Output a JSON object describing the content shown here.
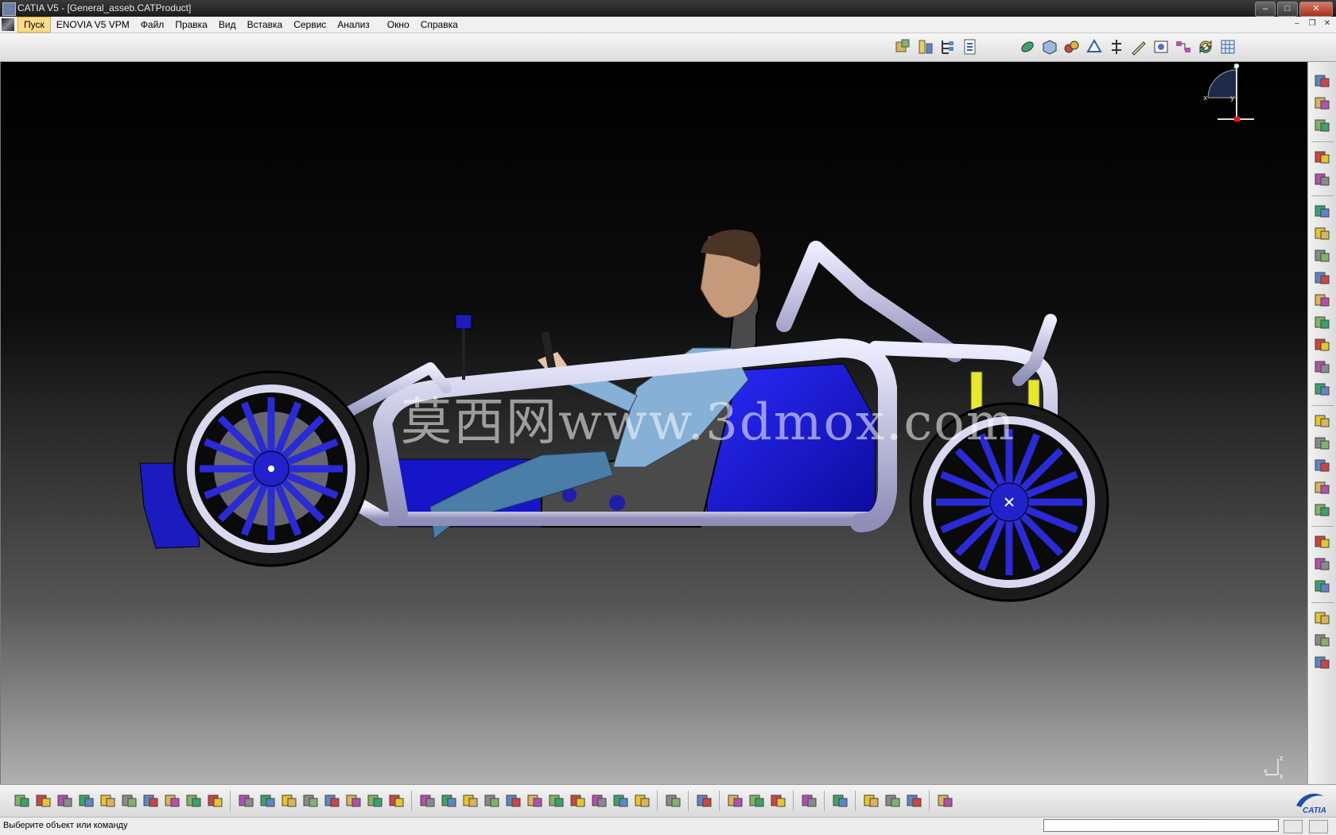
{
  "window": {
    "title": "CATIA V5 - [General_asseb.CATProduct]",
    "controls": {
      "minimize": "–",
      "maximize": "□",
      "close": "✕"
    }
  },
  "menu": {
    "items": [
      "Пуск",
      "ENOVIA V5 VPM",
      "Файл",
      "Правка",
      "Вид",
      "Вставка",
      "Сервис",
      "Анализ",
      "Окно",
      "Справка"
    ],
    "active_index": 0,
    "mdi_controls": {
      "minimize": "–",
      "restore": "❐",
      "close": "✕"
    }
  },
  "top_toolbar": {
    "icons": [
      "assembly-constraints-icon",
      "product-structure-icon",
      "spec-tree-icon",
      "catalog-icon",
      "render-icon",
      "sectioning-icon",
      "clash-icon",
      "measure-icon",
      "distance-icon",
      "sketch-icon",
      "snapshot-icon",
      "connect-icon",
      "update-icon",
      "grid-icon"
    ]
  },
  "viewport": {
    "watermark": "莫西网www.3dmox.com",
    "compass_labels": {
      "x": "x",
      "y": "y",
      "z": "z"
    },
    "colors": {
      "background_top": "#000000",
      "background_bottom": "#b0b0b0",
      "frame_tube": "#c9c9e6",
      "body_panel": "#1414c8",
      "tire": "#1b1b1b",
      "driver_suit": "#4a7ea8",
      "shock_absorber": "#e8e82a"
    }
  },
  "right_toolbar": {
    "icons": [
      "gear-icon",
      "doc-icon",
      "doc-icon",
      "select-arrow-icon",
      "manipulate-icon",
      "component-icon",
      "component-icon",
      "component-icon",
      "insert-icon",
      "replace-icon",
      "move-icon",
      "reorder-icon",
      "table-icon",
      "multi-instantiate-icon",
      "bill-of-material-icon",
      "constraint-icon",
      "constraint-icon",
      "fix-icon",
      "coincidence-icon",
      "contact-icon",
      "offset-icon",
      "angle-icon",
      "update-icon",
      "publish-icon",
      "scene-icon"
    ]
  },
  "bottom_toolbar": {
    "icons": [
      "new-icon",
      "open-icon",
      "save-icon",
      "print-icon",
      "cut-icon",
      "copy-icon",
      "paste-icon",
      "undo-icon",
      "redo-icon",
      "whats-this-icon",
      "formula-icon",
      "comment-icon",
      "pin-icon",
      "table-icon",
      "tree-icon",
      "lock-icon",
      "filter-icon",
      "fly-icon",
      "fit-all-icon",
      "pan-icon",
      "rotate-icon",
      "zoom-in-icon",
      "zoom-out-icon",
      "normal-view-icon",
      "multi-view-icon",
      "iso-view-icon",
      "shading-icon",
      "hide-show-icon",
      "swap-icon",
      "camera-icon",
      "apply-material-icon",
      "dimension-icon",
      "measure-item-icon",
      "inertia-icon",
      "sectioning-icon",
      "flatten-icon",
      "render-icon",
      "material-icon",
      "catalog-icon",
      "grid-icon"
    ]
  },
  "status": {
    "message": "Выберите объект или команду",
    "command_value": ""
  },
  "branding": {
    "logo_text": "CATIA"
  }
}
